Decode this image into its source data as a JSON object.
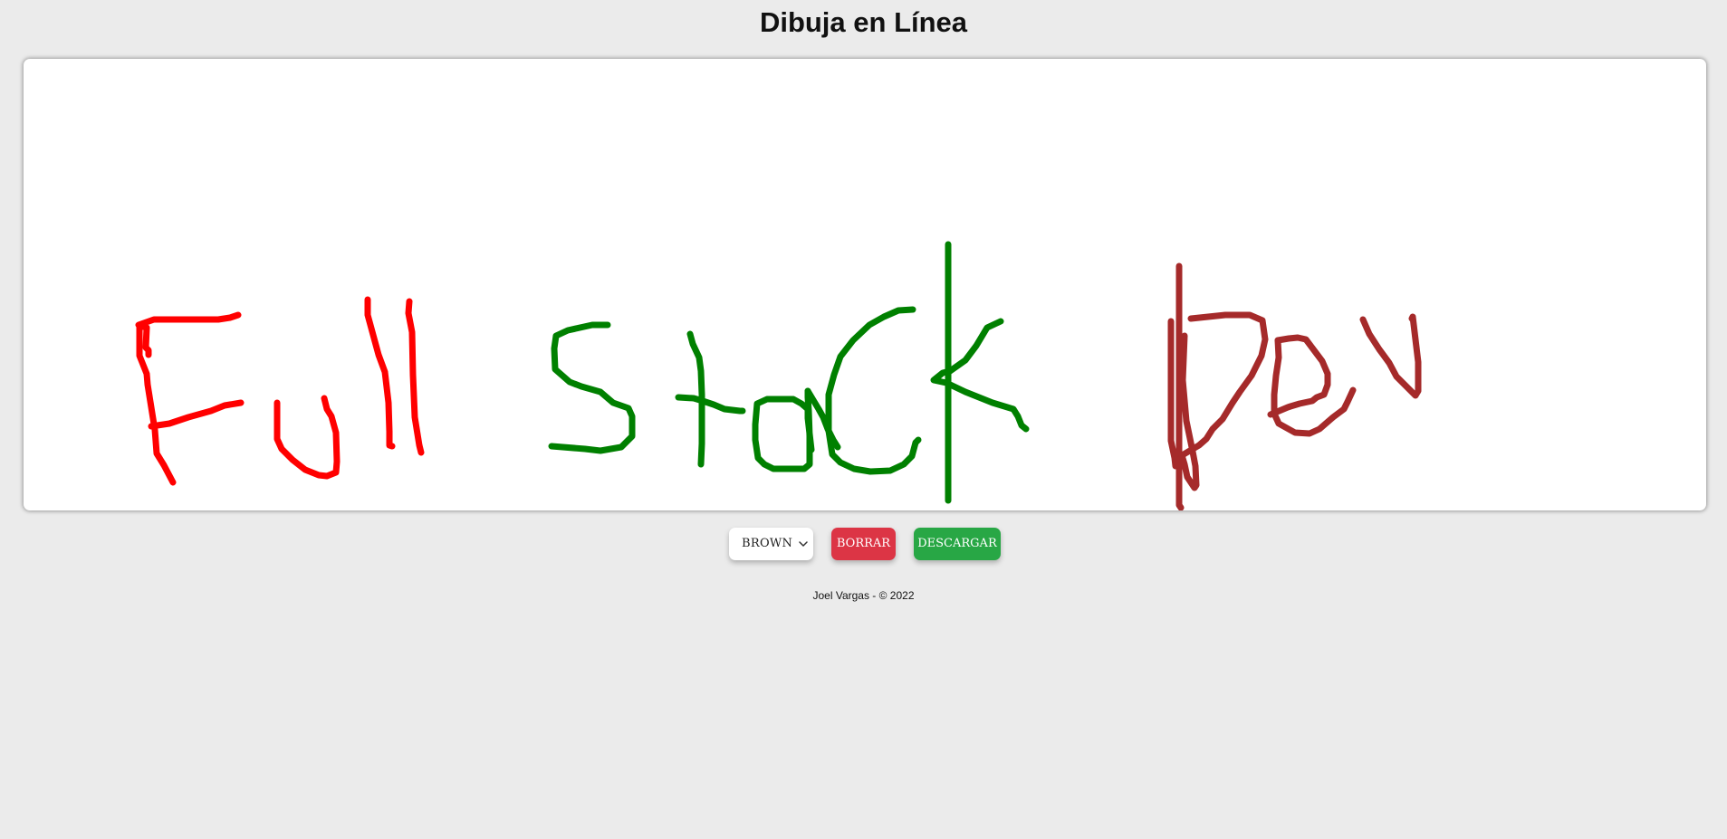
{
  "header": {
    "title": "Dibuja en Línea"
  },
  "canvas": {
    "background": "#ffffff",
    "strokes": [
      {
        "word": "Full",
        "color": "#ff0000"
      },
      {
        "word": "Stack",
        "color": "#008000"
      },
      {
        "word": "Dev",
        "color": "#a52a2a"
      }
    ]
  },
  "toolbar": {
    "color_select": {
      "selected": "BROWN",
      "icon": "chevron-down-icon"
    },
    "clear_label": "BORRAR",
    "download_label": "DESCARGAR",
    "colors": {
      "clear": "#dc3545",
      "download": "#28a745"
    }
  },
  "footer": {
    "text": "Joel Vargas - © 2022"
  }
}
